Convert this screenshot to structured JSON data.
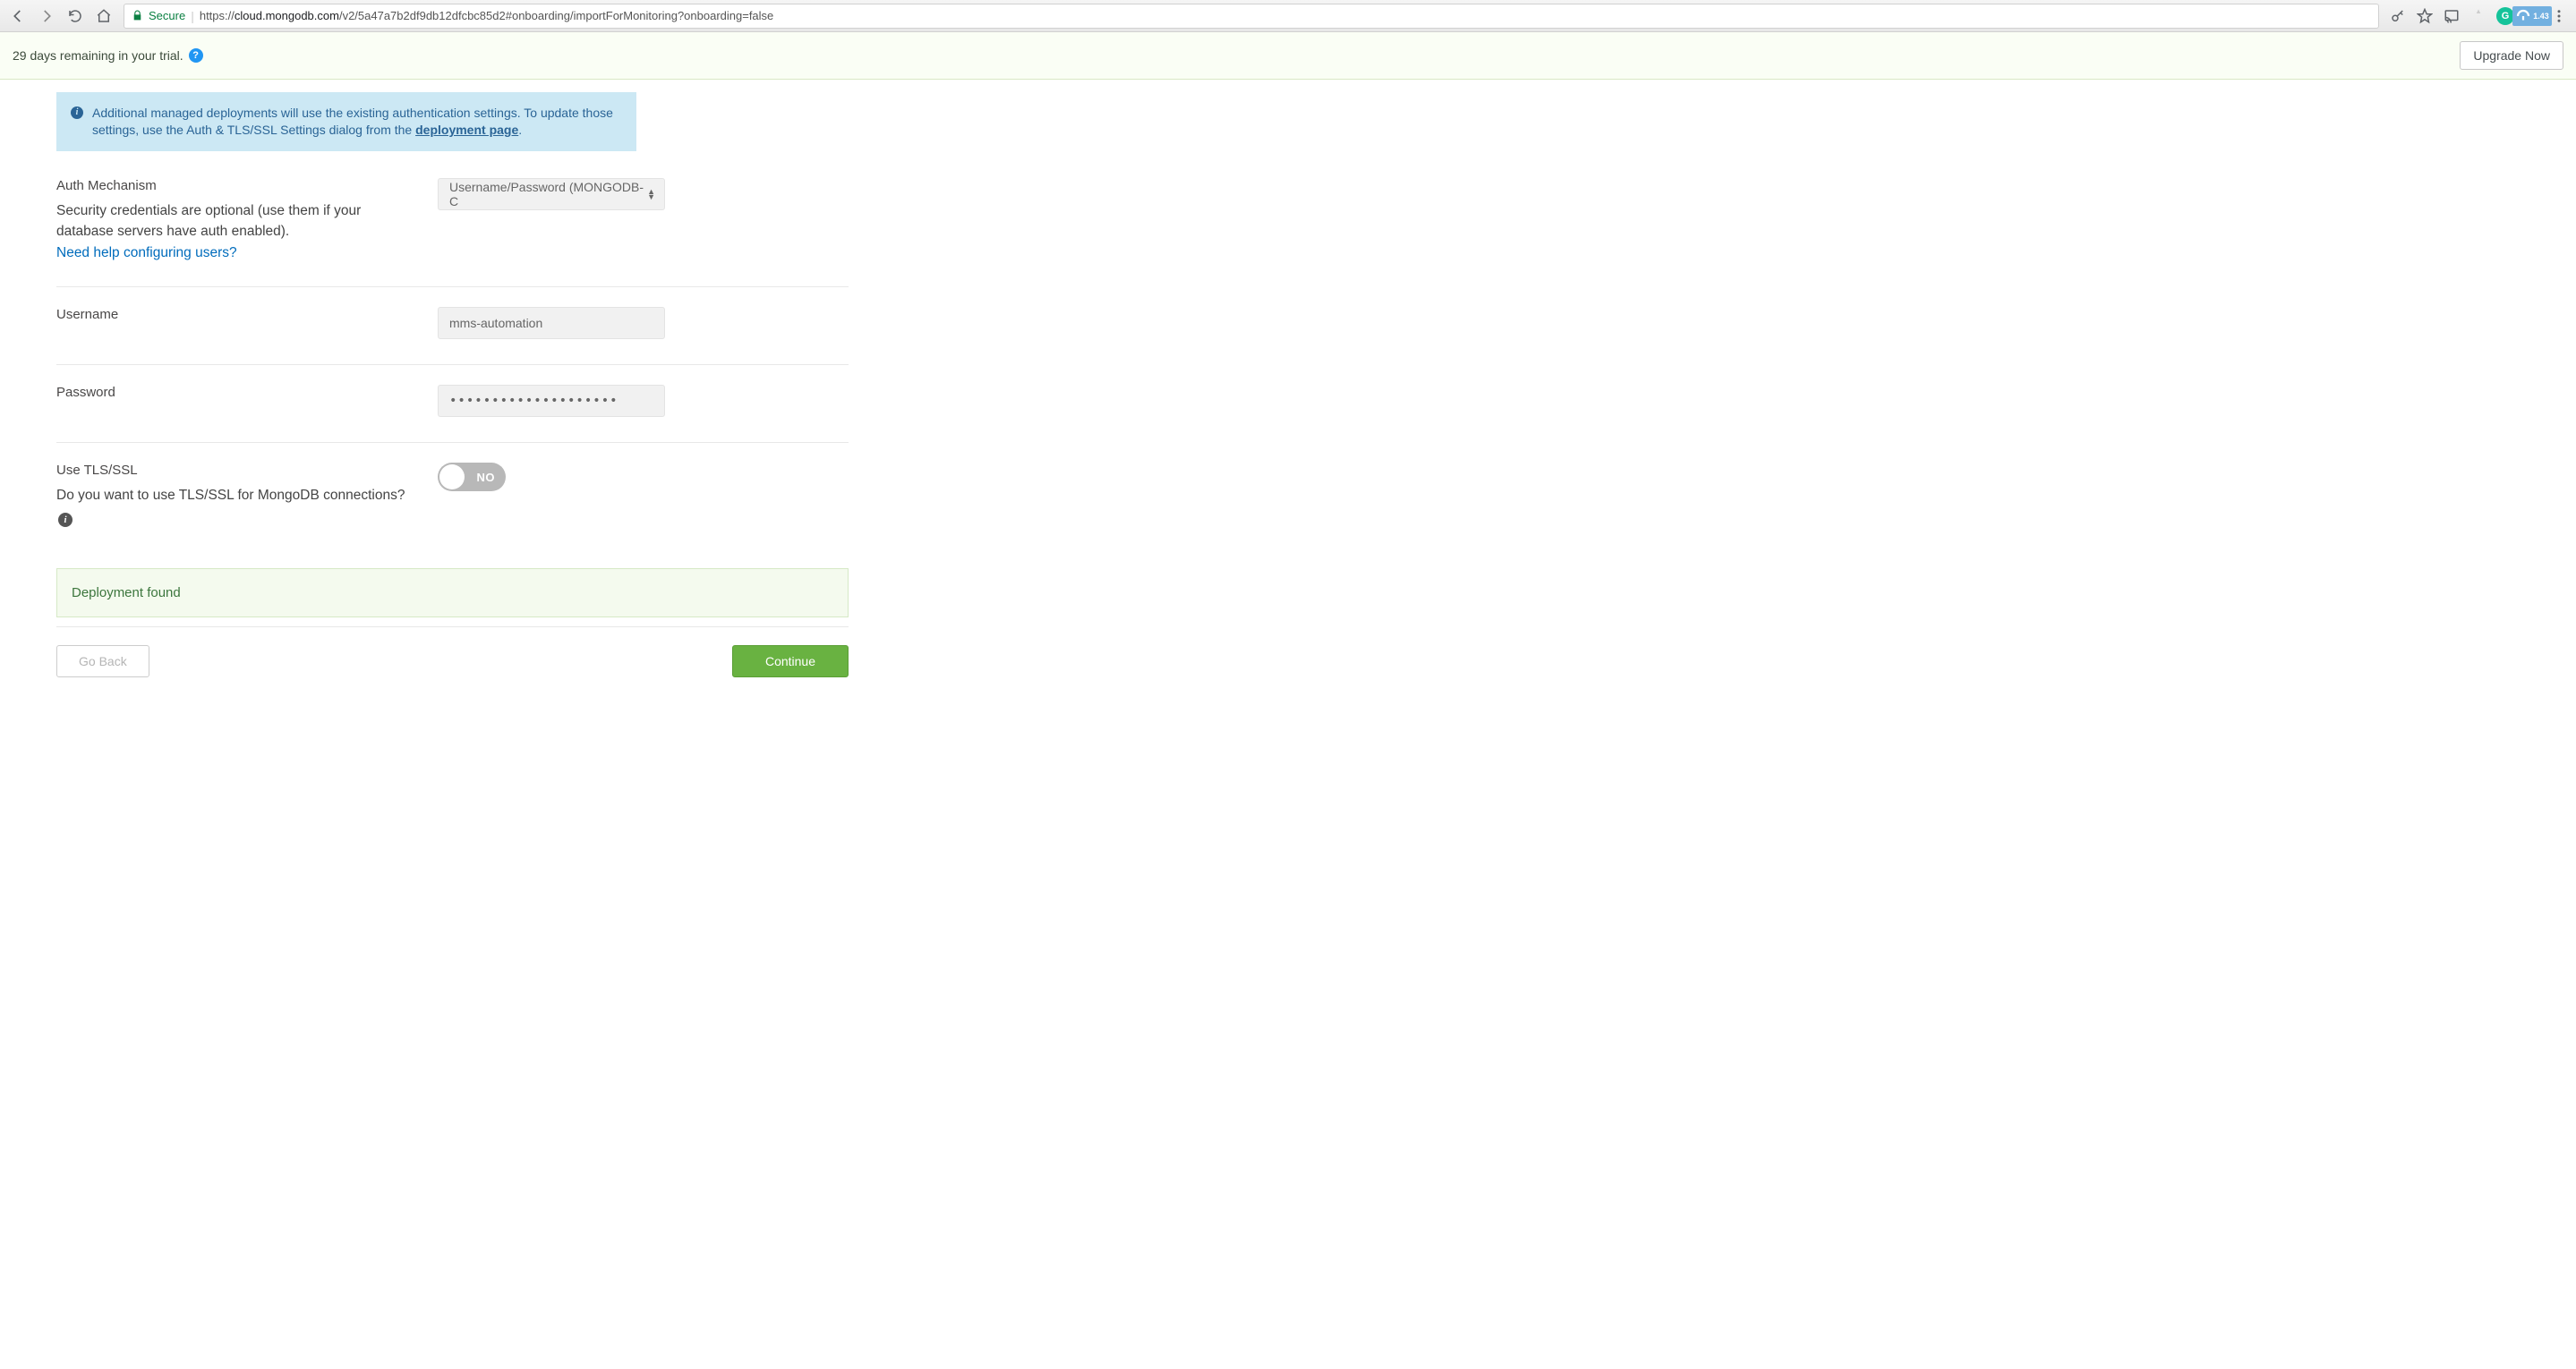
{
  "browser": {
    "secure_label": "Secure",
    "url_prefix": "https://",
    "url_domain": "cloud.mongodb.com",
    "url_path": "/v2/5a47a7b2df9db12dfcbc85d2#onboarding/importForMonitoring?onboarding=false",
    "ext_badge": "1.43"
  },
  "trial": {
    "message": "29 days remaining in your trial.",
    "upgrade_label": "Upgrade Now"
  },
  "info_alert": {
    "text": "Additional managed deployments will use the existing authentication settings. To update those settings, use the Auth & TLS/SSL Settings dialog from the ",
    "link_text": "deployment page",
    "period": "."
  },
  "auth": {
    "label": "Auth Mechanism",
    "help": "Security credentials are optional (use them if your database servers have auth enabled).",
    "link": "Need help configuring users?",
    "selected": "Username/Password (MONGODB-C"
  },
  "username": {
    "label": "Username",
    "value": "mms-automation"
  },
  "password": {
    "label": "Password",
    "value": "••••••••••••••••••••"
  },
  "tls": {
    "label": "Use TLS/SSL",
    "help": "Do you want to use TLS/SSL for MongoDB connections?",
    "state": "NO"
  },
  "success": {
    "text": "Deployment found"
  },
  "actions": {
    "back": "Go Back",
    "continue": "Continue"
  }
}
